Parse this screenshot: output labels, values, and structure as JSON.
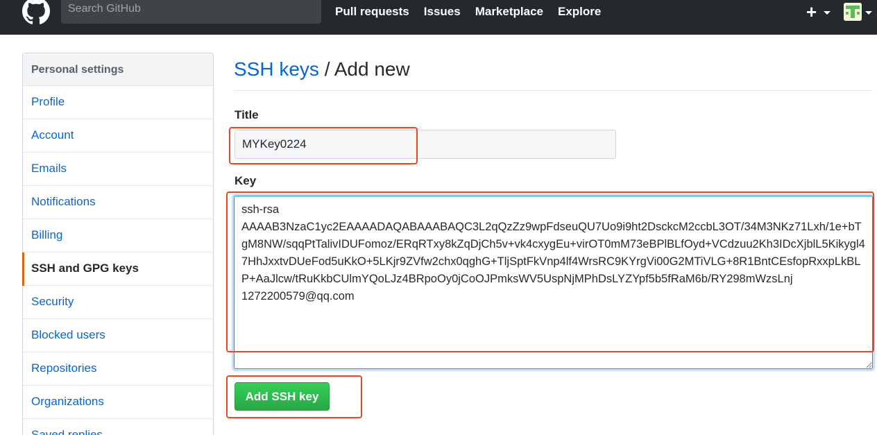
{
  "header": {
    "search_placeholder": "Search GitHub",
    "nav": [
      "Pull requests",
      "Issues",
      "Marketplace",
      "Explore"
    ],
    "new_icon": "plus-icon",
    "plus_glyph": "+",
    "avatar_icon": "user-avatar"
  },
  "sidebar": {
    "heading": "Personal settings",
    "items": [
      {
        "label": "Profile",
        "selected": false
      },
      {
        "label": "Account",
        "selected": false
      },
      {
        "label": "Emails",
        "selected": false
      },
      {
        "label": "Notifications",
        "selected": false
      },
      {
        "label": "Billing",
        "selected": false
      },
      {
        "label": "SSH and GPG keys",
        "selected": true
      },
      {
        "label": "Security",
        "selected": false
      },
      {
        "label": "Blocked users",
        "selected": false
      },
      {
        "label": "Repositories",
        "selected": false
      },
      {
        "label": "Organizations",
        "selected": false
      },
      {
        "label": "Saved replies",
        "selected": false
      }
    ]
  },
  "main": {
    "breadcrumb_link": "SSH keys",
    "breadcrumb_separator": " / ",
    "breadcrumb_current": "Add new",
    "title_label": "Title",
    "title_value": "MYKey0224",
    "key_label": "Key",
    "key_value": "ssh-rsa\nAAAAB3NzaC1yc2EAAAADAQABAAABAQC3L2qQzZz9wpFdseuQU7Uo9i9ht2DsckcM2ccbL3OT/34M3NKz71Lxh/1e+bTgM8NW/sqqPtTalivIDUFomoz/ERqRTxy8kZqDjCh5v+vk4cxygEu+virOT0mM73eBPlBLfOyd+VCdzuu2Kh3IDcXjblL5Kikygl47HhJxxtvDUeFod5uKkO+5LKjr9ZVfw2chx0qghG+TljSptFkVnp4lf4WrsRC9KYrgVi00G2MTiVLG+8R1BntCEsfopRxxpLkBLP+AaJlcw/tRuKkbCUlmYQoLJz4BRpoOy0jCoOJPmksWV5UspNjMPhDsLYZYpf5b5fRaM6b/RY298mWzsLnj 1272200579@qq.com",
    "submit_label": "Add SSH key"
  },
  "colors": {
    "header_bg": "#24292e",
    "link": "#0366d6",
    "selected_accent": "#e36209",
    "button_green": "#28a745",
    "annotation_red": "#f0451c"
  }
}
